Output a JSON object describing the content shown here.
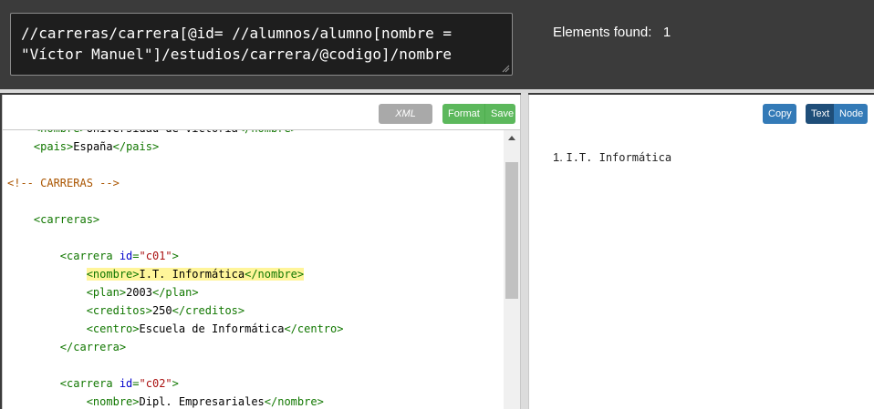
{
  "query": {
    "line1": "//carreras/carrera[@id= //alumnos/alumno[nombre =",
    "line2": "\"Víctor Manuel\"]/estudios/carrera/@codigo]/nombre"
  },
  "status": {
    "elements_found_label": "Elements found:",
    "elements_found_count": "1"
  },
  "editor": {
    "xml_mode_label": "XML mode",
    "format_label": "Format",
    "save_label": "Save",
    "lines": [
      {
        "parts": [
          [
            "t",
            "<nombre>"
          ],
          [
            "x",
            "Universidad de Victoria"
          ],
          [
            "t",
            "</nombre>"
          ]
        ],
        "indent": "    "
      },
      {
        "parts": [
          [
            "t",
            "<pais>"
          ],
          [
            "x",
            "España"
          ],
          [
            "t",
            "</pais>"
          ]
        ],
        "indent": "    "
      },
      {
        "parts": [],
        "indent": ""
      },
      {
        "parts": [
          [
            "c",
            "<!-- CARRERAS -->"
          ]
        ],
        "indent": ""
      },
      {
        "parts": [],
        "indent": ""
      },
      {
        "parts": [
          [
            "t",
            "<carreras>"
          ]
        ],
        "indent": "    "
      },
      {
        "parts": [],
        "indent": ""
      },
      {
        "parts": [
          [
            "t",
            "<carrera "
          ],
          [
            "a",
            "id"
          ],
          [
            "t",
            "="
          ],
          [
            "v",
            "\"c01\""
          ],
          [
            "t",
            ">"
          ]
        ],
        "indent": "        "
      },
      {
        "parts": [
          [
            "h",
            "<nombre>"
          ],
          [
            "hx",
            "I.T. Informática"
          ],
          [
            "h",
            "</nombre>"
          ]
        ],
        "indent": "            "
      },
      {
        "parts": [
          [
            "t",
            "<plan>"
          ],
          [
            "x",
            "2003"
          ],
          [
            "t",
            "</plan>"
          ]
        ],
        "indent": "            "
      },
      {
        "parts": [
          [
            "t",
            "<creditos>"
          ],
          [
            "x",
            "250"
          ],
          [
            "t",
            "</creditos>"
          ]
        ],
        "indent": "            "
      },
      {
        "parts": [
          [
            "t",
            "<centro>"
          ],
          [
            "x",
            "Escuela de Informática"
          ],
          [
            "t",
            "</centro>"
          ]
        ],
        "indent": "            "
      },
      {
        "parts": [
          [
            "t",
            "</carrera>"
          ]
        ],
        "indent": "        "
      },
      {
        "parts": [],
        "indent": ""
      },
      {
        "parts": [
          [
            "t",
            "<carrera "
          ],
          [
            "a",
            "id"
          ],
          [
            "t",
            "="
          ],
          [
            "v",
            "\"c02\""
          ],
          [
            "t",
            ">"
          ]
        ],
        "indent": "        "
      },
      {
        "parts": [
          [
            "t",
            "<nombre>"
          ],
          [
            "x",
            "Dipl. Empresariales"
          ],
          [
            "t",
            "</nombre>"
          ]
        ],
        "indent": "            "
      }
    ]
  },
  "results": {
    "copy_label": "Copy",
    "text_label": "Text",
    "node_label": "Node",
    "items": [
      {
        "number": "1.",
        "value": "I.T. Informática"
      }
    ]
  },
  "colors": {
    "tag": "#117700",
    "attr": "#0000cc",
    "value": "#aa1111",
    "comment": "#aa5500",
    "highlight": "#fff59a",
    "success": "#5cb85c",
    "primary": "#337ab7"
  }
}
